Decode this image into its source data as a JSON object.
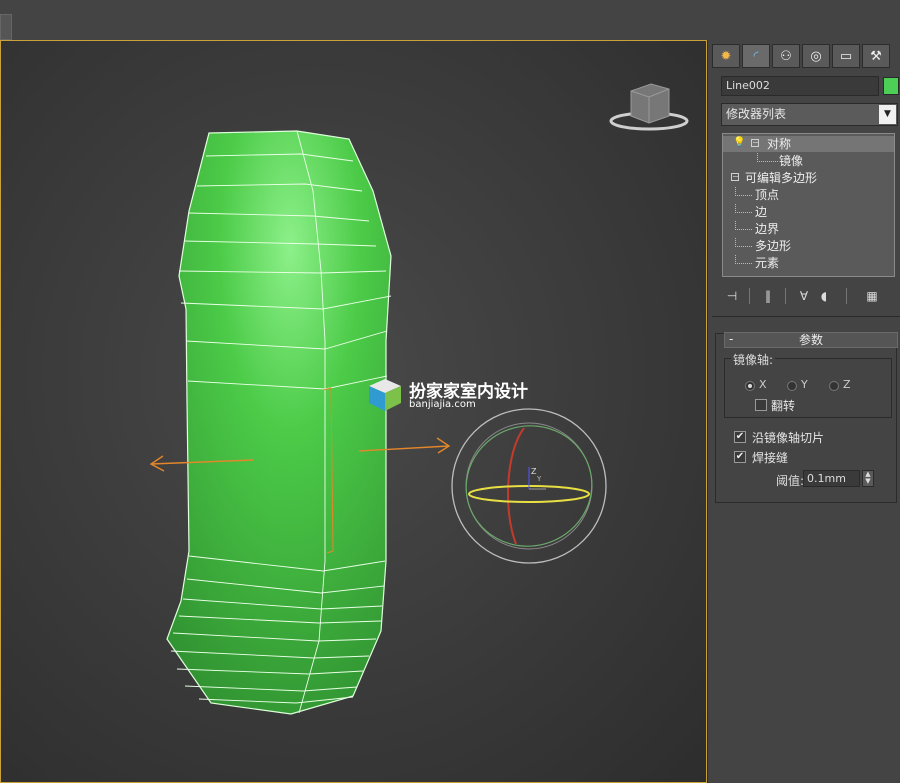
{
  "viewport": {
    "watermark_title": "扮家家室内设计",
    "watermark_url": "banjiajia.com",
    "gizmo_axis_label": "Z",
    "gizmo_axis_label_2": "Y"
  },
  "command_panel": {
    "tabs": [
      {
        "icon": "create-icon"
      },
      {
        "icon": "modify-icon"
      },
      {
        "icon": "hierarchy-icon"
      },
      {
        "icon": "motion-icon"
      },
      {
        "icon": "display-icon"
      },
      {
        "icon": "utilities-icon"
      }
    ],
    "object_name": "Line002",
    "object_color": "#4cce57",
    "modifier_list": "修改器列表",
    "stack": {
      "symmetry": "对称",
      "mirror": "镜像",
      "editable_poly": "可编辑多边形",
      "vertex": "顶点",
      "edge": "边",
      "border": "边界",
      "polygon": "多边形",
      "element": "元素"
    },
    "rollout": {
      "title": "参数",
      "mirror_axis": "镜像轴:",
      "axis_x": "X",
      "axis_y": "Y",
      "axis_z": "Z",
      "flip": "翻转",
      "slice_along_mirror": "沿镜像轴切片",
      "weld_seam": "焊接缝",
      "threshold_label": "阈值:",
      "threshold_value": "0.1mm"
    }
  }
}
